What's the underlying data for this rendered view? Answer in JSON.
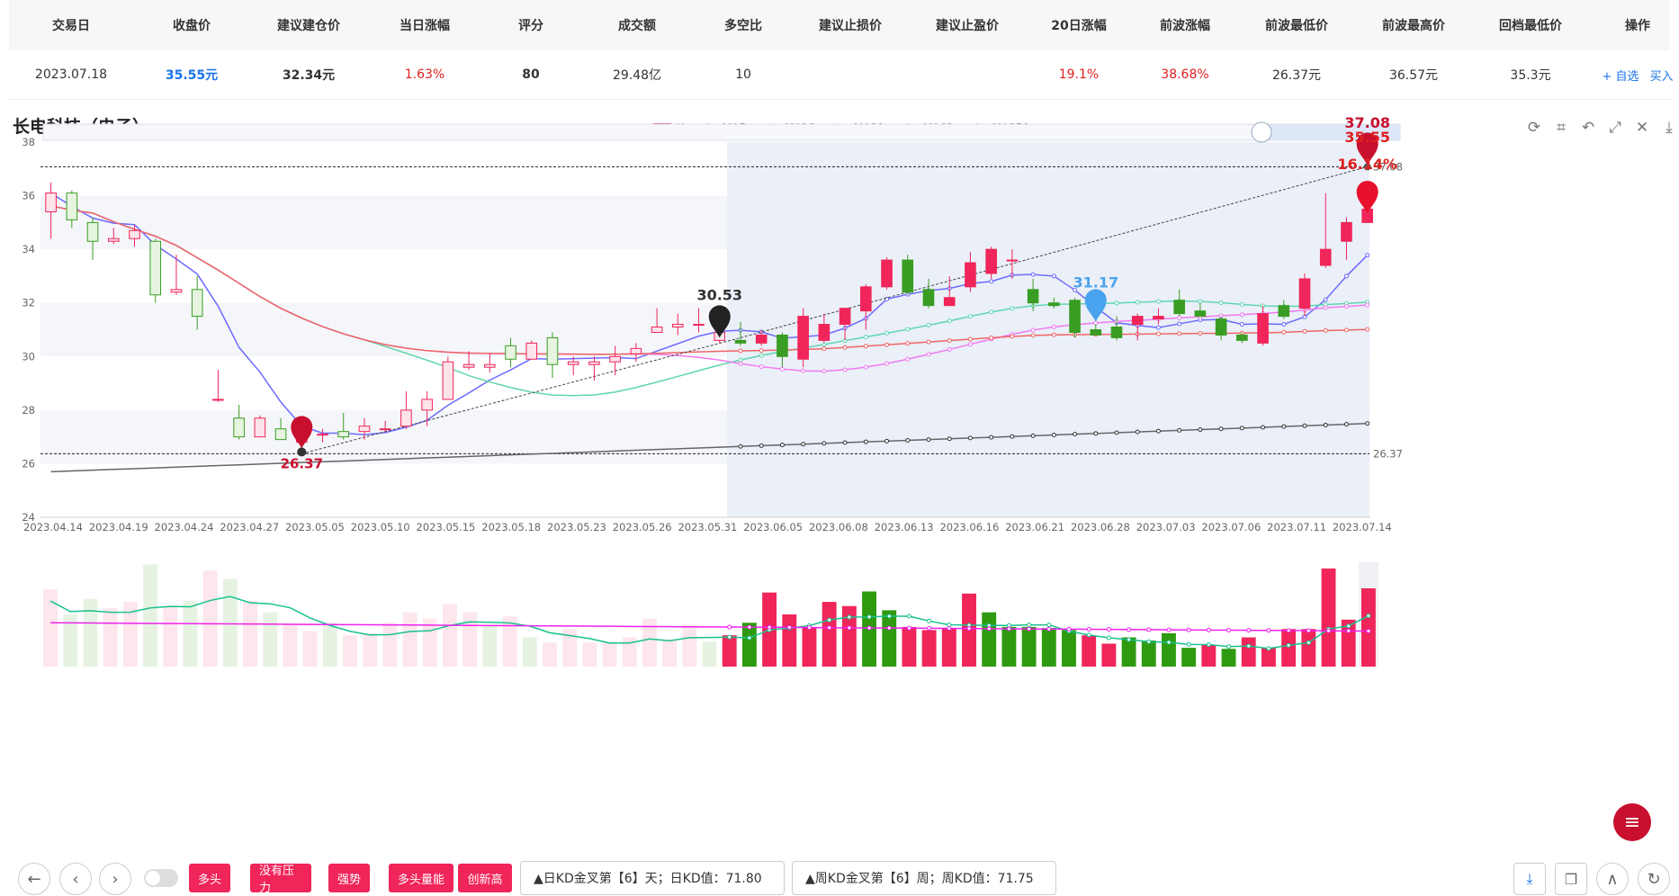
{
  "table": {
    "headers": [
      "交易日",
      "收盘价",
      "建议建仓价",
      "当日涨幅",
      "评分",
      "成交额",
      "多空比",
      "建议止损价",
      "建议止盈价",
      "20日涨幅",
      "前波涨幅",
      "前波最低价",
      "前波最高价",
      "回档最低价",
      "操作"
    ],
    "row": [
      "2023.07.18",
      "35.55元",
      "32.34元",
      "1.63%",
      "80",
      "29.48亿",
      "10",
      "",
      "",
      "19.1%",
      "38.68%",
      "26.37元",
      "36.57元",
      "35.3元"
    ],
    "actions": [
      "+ 自选",
      "买入"
    ]
  },
  "stock_title": "长电科技（电子）",
  "legend": [
    {
      "name": "K",
      "color": "#f0255a"
    },
    {
      "name": "MA5",
      "color": "#2222dd"
    },
    {
      "name": "MA18",
      "color": "#2bc59a"
    },
    {
      "name": "MA31",
      "color": "#ee44ee"
    },
    {
      "name": "MA63",
      "color": "#e03030"
    },
    {
      "name": "MA250",
      "color": "#222222"
    }
  ],
  "chart_data": {
    "type": "candlestick",
    "x_ticks": [
      "2023.04.14",
      "2023.04.19",
      "2023.04.24",
      "2023.04.27",
      "2023.05.05",
      "2023.05.10",
      "2023.05.15",
      "2023.05.18",
      "2023.05.23",
      "2023.05.26",
      "2023.05.31",
      "2023.06.05",
      "2023.06.08",
      "2023.06.13",
      "2023.06.16",
      "2023.06.21",
      "2023.06.28",
      "2023.07.03",
      "2023.07.06",
      "2023.07.11",
      "2023.07.14"
    ],
    "y_ticks": [
      24,
      26,
      28,
      30,
      32,
      34,
      36,
      38
    ],
    "ylim": [
      24,
      38
    ],
    "candles": [
      [
        35.4,
        36.1,
        34.4,
        36.5
      ],
      [
        36.1,
        35.1,
        34.8,
        36.2
      ],
      [
        35.0,
        34.3,
        33.6,
        35.2
      ],
      [
        34.3,
        34.4,
        34.2,
        34.8
      ],
      [
        34.4,
        34.7,
        34.1,
        34.9
      ],
      [
        34.3,
        32.3,
        32.0,
        34.4
      ],
      [
        32.4,
        32.5,
        32.3,
        33.8
      ],
      [
        32.5,
        31.5,
        31.0,
        33.0
      ],
      [
        28.4,
        28.4,
        28.3,
        29.5
      ],
      [
        27.7,
        27.0,
        26.9,
        28.2
      ],
      [
        27.0,
        27.7,
        27.0,
        27.8
      ],
      [
        27.3,
        26.9,
        26.9,
        27.7
      ],
      [
        26.8,
        27.0,
        26.8,
        27.4
      ],
      [
        27.1,
        27.1,
        26.8,
        27.3
      ],
      [
        27.2,
        27.0,
        26.9,
        27.9
      ],
      [
        27.2,
        27.4,
        26.9,
        27.7
      ],
      [
        27.3,
        27.3,
        27.2,
        27.6
      ],
      [
        27.4,
        28.0,
        27.3,
        28.7
      ],
      [
        28.0,
        28.4,
        27.4,
        28.7
      ],
      [
        28.4,
        29.8,
        28.4,
        30.0
      ],
      [
        29.6,
        29.7,
        29.5,
        30.2
      ],
      [
        29.6,
        29.7,
        29.4,
        30.1
      ],
      [
        30.4,
        29.9,
        29.6,
        30.7
      ],
      [
        29.9,
        30.5,
        29.9,
        30.6
      ],
      [
        30.7,
        29.7,
        29.2,
        30.9
      ],
      [
        29.7,
        29.8,
        29.3,
        30.0
      ],
      [
        29.7,
        29.8,
        29.1,
        30.0
      ],
      [
        29.8,
        30.0,
        29.3,
        30.4
      ],
      [
        30.1,
        30.3,
        29.8,
        30.5
      ],
      [
        30.9,
        31.1,
        30.9,
        31.8
      ],
      [
        31.1,
        31.2,
        30.8,
        31.6
      ],
      [
        31.2,
        31.2,
        30.9,
        31.8
      ],
      [
        30.6,
        30.9,
        30.5,
        31.2
      ],
      [
        30.6,
        30.5,
        30.4,
        31.3
      ],
      [
        30.5,
        30.8,
        30.4,
        31.0
      ],
      [
        30.8,
        30.0,
        29.6,
        30.9
      ],
      [
        29.9,
        31.5,
        29.6,
        31.8
      ],
      [
        30.6,
        31.2,
        30.5,
        31.6
      ],
      [
        31.2,
        31.8,
        30.6,
        31.8
      ],
      [
        31.7,
        32.6,
        31.0,
        32.7
      ],
      [
        32.6,
        33.6,
        32.5,
        33.7
      ],
      [
        33.6,
        32.4,
        32.3,
        33.8
      ],
      [
        32.5,
        31.9,
        31.8,
        32.9
      ],
      [
        31.9,
        32.2,
        31.9,
        33.0
      ],
      [
        32.6,
        33.5,
        32.4,
        33.9
      ],
      [
        33.1,
        34.0,
        32.9,
        34.1
      ],
      [
        33.6,
        33.6,
        32.9,
        34.0
      ],
      [
        32.5,
        32.0,
        31.7,
        32.9
      ],
      [
        32.0,
        31.9,
        31.8,
        32.2
      ],
      [
        32.1,
        30.9,
        30.7,
        32.2
      ],
      [
        31.0,
        30.8,
        30.9,
        31.2
      ],
      [
        31.1,
        30.7,
        30.6,
        31.5
      ],
      [
        31.2,
        31.5,
        30.6,
        31.6
      ],
      [
        31.4,
        31.5,
        31.2,
        31.8
      ],
      [
        32.1,
        31.6,
        31.5,
        32.5
      ],
      [
        31.7,
        31.5,
        31.5,
        32.0
      ],
      [
        31.4,
        30.8,
        30.6,
        31.5
      ],
      [
        30.8,
        30.6,
        30.5,
        30.9
      ],
      [
        30.5,
        31.6,
        30.4,
        31.9
      ],
      [
        31.9,
        31.5,
        31.4,
        32.1
      ],
      [
        31.8,
        32.9,
        31.5,
        33.1
      ],
      [
        33.4,
        34.0,
        33.3,
        36.1
      ],
      [
        34.3,
        35.0,
        33.6,
        35.2
      ],
      [
        35.0,
        35.5,
        35.2,
        35.8
      ]
    ],
    "ma250": {
      "start": 25.7,
      "end": 27.5
    },
    "markers": [
      {
        "label": "26.37",
        "type": "low"
      },
      {
        "label": "30.53",
        "type": "mid"
      },
      {
        "label": "31.17",
        "type": "blue"
      },
      {
        "label": "37.08",
        "type": "high"
      },
      {
        "label": "35.55",
        "type": "close"
      },
      {
        "label": "16.14%",
        "type": "pct"
      }
    ],
    "hlines": [
      {
        "value": 37.08,
        "label": "37.08"
      },
      {
        "value": 26.37,
        "label": "26.37"
      }
    ],
    "volume": [
      0.74,
      0.5,
      0.65,
      0.56,
      0.62,
      0.98,
      0.58,
      0.63,
      0.92,
      0.84,
      0.63,
      0.52,
      0.41,
      0.34,
      0.42,
      0.3,
      0.32,
      0.42,
      0.52,
      0.46,
      0.6,
      0.52,
      0.4,
      0.48,
      0.28,
      0.23,
      0.36,
      0.23,
      0.23,
      0.28,
      0.46,
      0.26,
      0.4,
      0.24,
      0.3,
      0.42,
      0.71,
      0.5,
      0.38,
      0.62,
      0.58,
      0.72,
      0.54,
      0.38,
      0.35,
      0.37,
      0.7,
      0.52,
      0.38,
      0.38,
      0.37,
      0.35,
      0.3,
      0.22,
      0.28,
      0.25,
      0.32,
      0.18,
      0.21,
      0.17,
      0.28,
      0.18,
      0.36,
      0.36,
      0.94,
      0.45,
      0.75
    ]
  },
  "bottom_tags": [
    "多头",
    "没有压力",
    "强势",
    "多头量能",
    "创新高"
  ],
  "info_day": "▲日KD金叉第【6】天；日KD值：71.80",
  "info_week": "▲周KD金叉第【6】周；周KD值：71.75"
}
